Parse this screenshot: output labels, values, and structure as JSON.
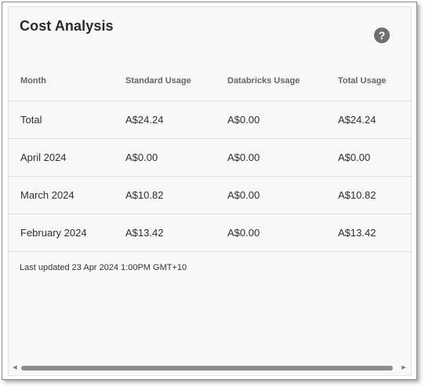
{
  "card": {
    "title": "Cost Analysis",
    "help_icon": "help-circle-icon",
    "help_glyph": "?"
  },
  "table": {
    "columns": [
      "Month",
      "Standard Usage",
      "Databricks Usage",
      "Total Usage"
    ],
    "rows": [
      [
        "Total",
        "A$24.24",
        "A$0.00",
        "A$24.24"
      ],
      [
        "April 2024",
        "A$0.00",
        "A$0.00",
        "A$0.00"
      ],
      [
        "March 2024",
        "A$10.82",
        "A$0.00",
        "A$10.82"
      ],
      [
        "February 2024",
        "A$13.42",
        "A$0.00",
        "A$13.42"
      ]
    ]
  },
  "footer": {
    "last_updated": "Last updated 23 Apr 2024 1:00PM GMT+10"
  },
  "scrollbar": {
    "left_arrow": "◀",
    "right_arrow": "▶"
  },
  "colors": {
    "card_background": "#f8f8f8",
    "help_icon": "#6f6f6f",
    "header_text": "#666666",
    "row_divider": "#dedede"
  }
}
